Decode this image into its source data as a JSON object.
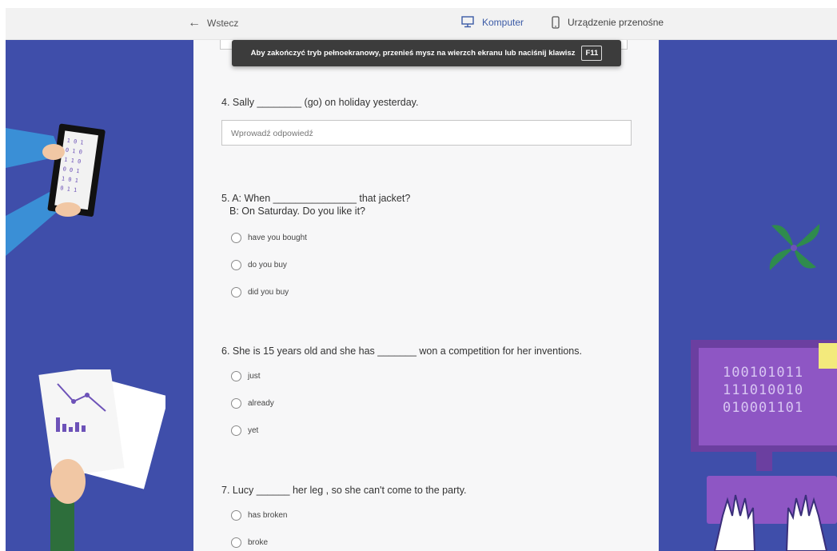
{
  "topbar": {
    "back_label": "Wstecz",
    "device_computer": "Komputer",
    "device_mobile": "Urządzenie przenośne"
  },
  "toast": {
    "message": "Aby zakończyć tryb pełnoekranowy, przenieś mysz na wierzch ekranu lub naciśnij klawisz",
    "key": "F11"
  },
  "questions": [
    {
      "number_text": "4. Sally ________ (go) on holiday yesterday.",
      "answer_placeholder": "Wprowadź odpowiedź"
    },
    {
      "line1": "5. A: When _______________ that jacket?",
      "line2": "B: On Saturday. Do you like it?",
      "options": [
        "have you bought",
        "do you buy",
        "did you buy"
      ]
    },
    {
      "number_text": "6. She is 15 years old and she has _______ won a competition for her inventions.",
      "options": [
        "just",
        "already",
        "yet"
      ]
    },
    {
      "number_text": "7. Lucy ______ her leg , so she can't come to the party.",
      "options": [
        "has broken",
        "broke"
      ]
    }
  ],
  "decor": {
    "monitor_binary": [
      "100101011",
      "111010010",
      "010001101"
    ],
    "background_color": "#3f4eaa",
    "accent_color": "#8e56c4"
  }
}
